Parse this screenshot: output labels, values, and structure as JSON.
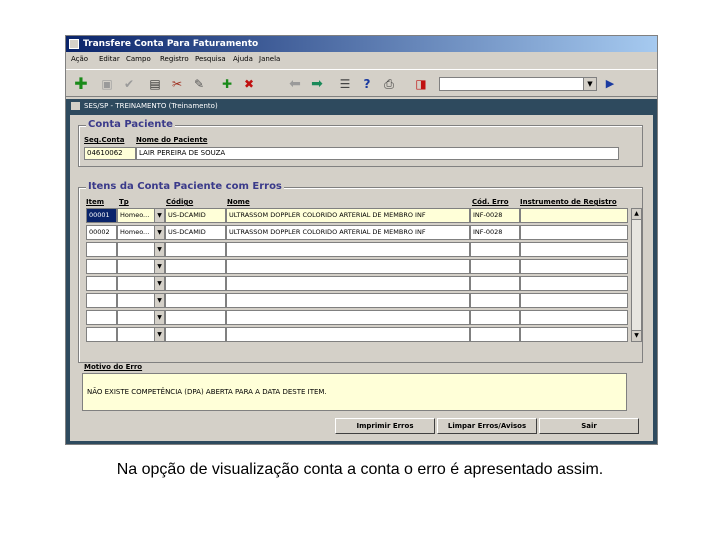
{
  "window": {
    "title": "Transfere Conta Para Faturamento"
  },
  "menu": [
    "Ação",
    "Editar",
    "Campo",
    "Registro",
    "Pesquisa",
    "Ajuda",
    "Janela"
  ],
  "toolbar_icons": [
    "add-green-cross-icon",
    "save-disk-icon",
    "check-icon",
    "print-preview-icon",
    "tools-icon",
    "edit-pencil-icon",
    "insert-record-icon",
    "delete-record-icon",
    "arrow-left-icon",
    "arrow-right-icon",
    "list-icon",
    "help-question-icon",
    "printer-icon",
    "exit-door-icon"
  ],
  "inner_window": {
    "title": "SES/SP - TREINAMENTO (Treinamento)"
  },
  "conta_paciente": {
    "title": "Conta Paciente",
    "seq_label": "Seq.Conta",
    "nome_label": "Nome do Paciente",
    "seq_value": "04610062",
    "nome_value": "LAIR PEREIRA DE SOUZA"
  },
  "itens": {
    "title": "Itens da Conta Paciente com Erros",
    "headers": {
      "item": "Item",
      "tp": "Tp",
      "codigo": "Código",
      "nome": "Nome",
      "cod_erro": "Cód. Erro",
      "instrumento": "Instrumento de Registro"
    },
    "rows": [
      {
        "item": "00001",
        "tp": "Homeo...",
        "codigo": "US-DCAMID",
        "nome": "ULTRASSOM DOPPLER COLORIDO ARTERIAL DE MEMBRO INF",
        "cod_erro": "INF-0028",
        "instrumento": ""
      },
      {
        "item": "00002",
        "tp": "Homeo...",
        "codigo": "US-DCAMID",
        "nome": "ULTRASSOM DOPPLER COLORIDO ARTERIAL DE MEMBRO INF",
        "cod_erro": "INF-0028",
        "instrumento": ""
      }
    ],
    "empty_rows": 6
  },
  "motivo": {
    "label": "Motivo do Erro",
    "text": "NÃO EXISTE COMPETÊNCIA (DPA) ABERTA PARA A DATA DESTE ITEM."
  },
  "buttons": {
    "imprimir": "Imprimir Erros",
    "limpar": "Limpar Erros/Avisos",
    "sair": "Sair"
  },
  "caption": "Na opção de visualização conta a conta o erro é apresentado assim."
}
